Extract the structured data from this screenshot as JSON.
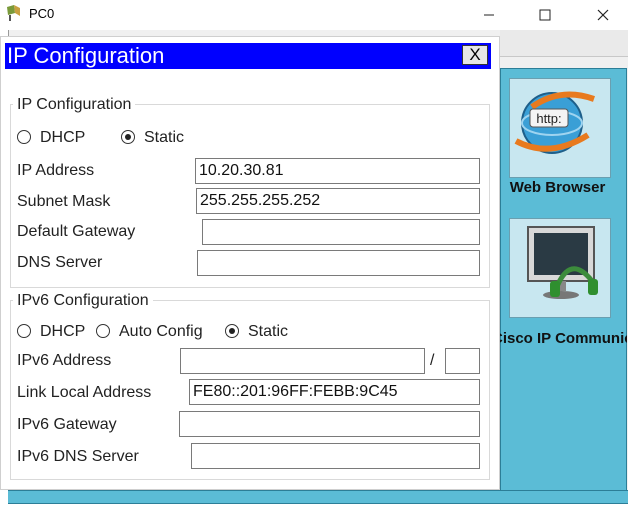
{
  "window": {
    "title": "PC0",
    "minimize": "—",
    "maximize": "☐",
    "close": "✕"
  },
  "desktop": {
    "web_browser_label": "Web Browser",
    "web_icon_text": "http:",
    "cisco_ip_communicator_label": "Cisco IP Communicator"
  },
  "dialog": {
    "title": "IP Configuration",
    "close_label": "X",
    "ipv4": {
      "group_title": "IP Configuration",
      "dhcp_label": "DHCP",
      "static_label": "Static",
      "selected_mode": "Static",
      "ip_address_label": "IP Address",
      "ip_address_value": "10.20.30.81",
      "subnet_mask_label": "Subnet Mask",
      "subnet_mask_value": "255.255.255.252",
      "default_gateway_label": "Default Gateway",
      "default_gateway_value": "",
      "dns_server_label": "DNS Server",
      "dns_server_value": ""
    },
    "ipv6": {
      "group_title": "IPv6 Configuration",
      "dhcp_label": "DHCP",
      "auto_config_label": "Auto Config",
      "static_label": "Static",
      "selected_mode": "Static",
      "ipv6_address_label": "IPv6 Address",
      "ipv6_address_value": "",
      "prefix_separator": "/",
      "prefix_length_value": "",
      "link_local_label": "Link Local Address",
      "link_local_value": "FE80::201:96FF:FEBB:9C45",
      "ipv6_gateway_label": "IPv6 Gateway",
      "ipv6_gateway_value": "",
      "ipv6_dns_label": "IPv6 DNS Server",
      "ipv6_dns_value": ""
    }
  }
}
